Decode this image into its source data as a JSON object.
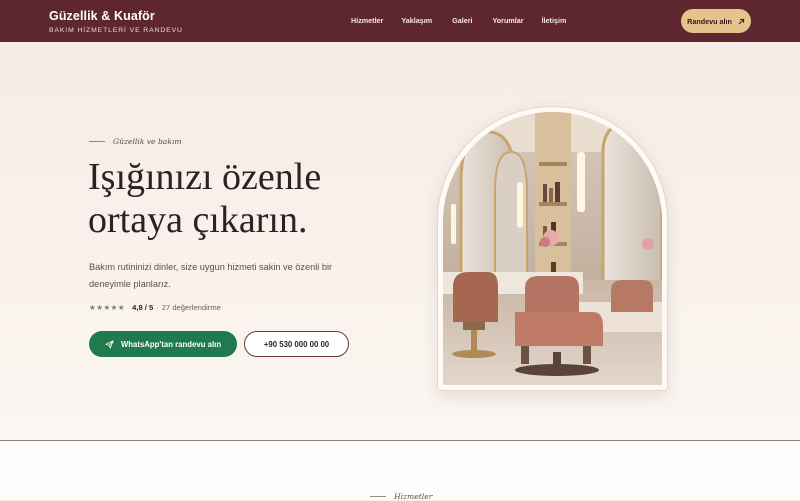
{
  "brand": {
    "title": "Güzellik & Kuaför",
    "subtitle": "BAKIM HİZMETLERİ VE RANDEVU"
  },
  "nav": {
    "items": [
      "Hizmetler",
      "Yaklaşım",
      "Galeri",
      "Yorumlar",
      "İletişim"
    ]
  },
  "header_cta": {
    "label": "Randevu alın",
    "icon": "arrow-up-right-icon"
  },
  "hero": {
    "eyebrow": "Güzellik ve bakım",
    "headline_line1": "Işığınızı özenle",
    "headline_line2": "ortaya çıkarın.",
    "description": "Bakım rutininizi dinler, size uygun hizmeti sakin ve özenli bir deneyimle planlarız.",
    "rating": {
      "stars": "★★★★★",
      "score": "4,8 / 5",
      "separator": "·",
      "reviews": "27 değerlendirme"
    },
    "whatsapp_button": "WhatsApp'tan randevu alın",
    "phone_button": "+90 530 000 00 00"
  },
  "next_section": {
    "eyebrow": "Hizmetler"
  },
  "colors": {
    "header_bg": "#5e2730",
    "accent_gold": "#e6c38d",
    "whatsapp_green": "#1f7a4d",
    "page_bg": "#f7efe8"
  }
}
